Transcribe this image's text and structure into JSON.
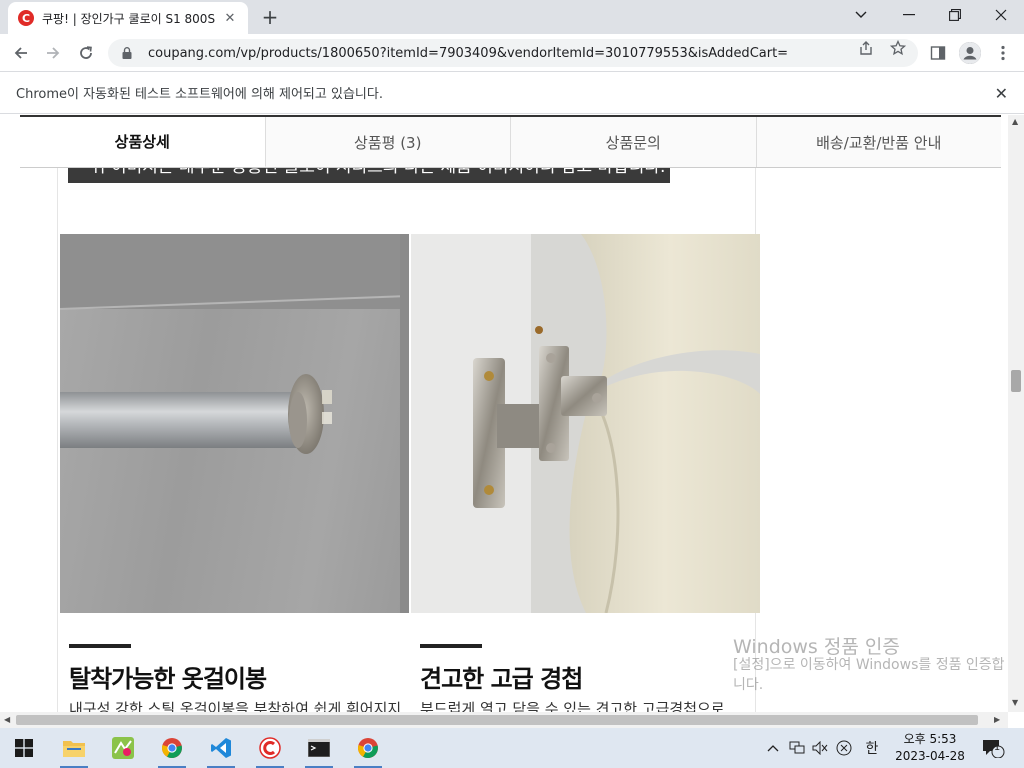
{
  "browser": {
    "tab_title": "쿠팡! | 장인가구 쿨로이 S1 800S",
    "favicon_letter": "C",
    "url": "coupang.com/vp/products/1800650?itemId=7903409&vendorItemId=3010779553&isAddedCart=",
    "new_tab_glyph": "+",
    "close_glyph": "✕"
  },
  "infobar": {
    "message": "Chrome이 자동화된 테스트 소프트웨어에 의해 제어되고 있습니다."
  },
  "product_tabs": [
    {
      "label": "상품상세",
      "active": true
    },
    {
      "label": "상품평 (3)",
      "active": false
    },
    {
      "label": "상품문의",
      "active": false
    },
    {
      "label": "배송/교환/반품 안내",
      "active": false
    }
  ],
  "detail": {
    "caption_partial": "* 위 이미지는 대부분 공통된 쿨로이 시리즈의 다른 제품 이미지이니 참고 바랍니다.",
    "features": [
      {
        "title": "탈착가능한 옷걸이봉",
        "desc": "내구성 강한 스틸 옷걸이봉을 부착하여 쉽게 휘어지지"
      },
      {
        "title": "견고한 고급 경첩",
        "desc": "부드럽게 열고 닫을 수 있는 견고한 고급경첩으로"
      }
    ]
  },
  "watermark": {
    "title": "Windows 정품 인증",
    "subtitle": "[설정]으로 이동하여 Windows를 정품 인증합니다."
  },
  "taskbar": {
    "ime_label": "한",
    "clock_time": "오후 5:53",
    "clock_date": "2023-04-28",
    "notification_count": "1"
  },
  "colors": {
    "coupang_red": "#e02b27",
    "tab_border": "#333333"
  }
}
